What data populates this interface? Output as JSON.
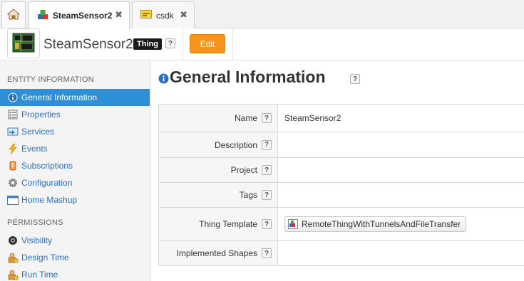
{
  "tabs": {
    "home_icon": "home-icon",
    "items": [
      {
        "label": "SteamSensor2",
        "icon": "thing-icon",
        "active": true,
        "close": "✖"
      },
      {
        "label": "csdk",
        "icon": "yellow-sdk-icon",
        "active": false,
        "close": "✖"
      }
    ]
  },
  "header": {
    "title": "SteamSensor2",
    "badge": "Thing",
    "help": "?",
    "edit_label": "Edit",
    "icon": "circuit-board-icon"
  },
  "sidebar": {
    "sections": [
      {
        "title": "ENTITY INFORMATION",
        "items": [
          {
            "label": "General Information",
            "icon": "info-icon",
            "active": true
          },
          {
            "label": "Properties",
            "icon": "properties-icon",
            "active": false
          },
          {
            "label": "Services",
            "icon": "services-icon",
            "active": false
          },
          {
            "label": "Events",
            "icon": "lightning-icon",
            "active": false
          },
          {
            "label": "Subscriptions",
            "icon": "subscriptions-icon",
            "active": false
          },
          {
            "label": "Configuration",
            "icon": "gear-icon",
            "active": false
          },
          {
            "label": "Home Mashup",
            "icon": "window-icon",
            "active": false
          }
        ]
      },
      {
        "title": "PERMISSIONS",
        "items": [
          {
            "label": "Visibility",
            "icon": "eye-icon",
            "active": false
          },
          {
            "label": "Design Time",
            "icon": "lock-user-icon",
            "active": false
          },
          {
            "label": "Run Time",
            "icon": "lock-user-icon",
            "active": false
          }
        ]
      }
    ]
  },
  "main": {
    "title": "General Information",
    "help": "?",
    "rows": [
      {
        "label": "Name",
        "value": "SteamSensor2"
      },
      {
        "label": "Description",
        "value": ""
      },
      {
        "label": "Project",
        "value": ""
      },
      {
        "label": "Tags",
        "value": ""
      },
      {
        "label": "Thing Template",
        "value": "RemoteThingWithTunnelsAndFileTransfer"
      },
      {
        "label": "Implemented Shapes",
        "value": ""
      }
    ]
  },
  "colors": {
    "accent_blue": "#2e8fd6",
    "link_blue": "#2a6ebb",
    "edit_orange": "#f7941d"
  }
}
